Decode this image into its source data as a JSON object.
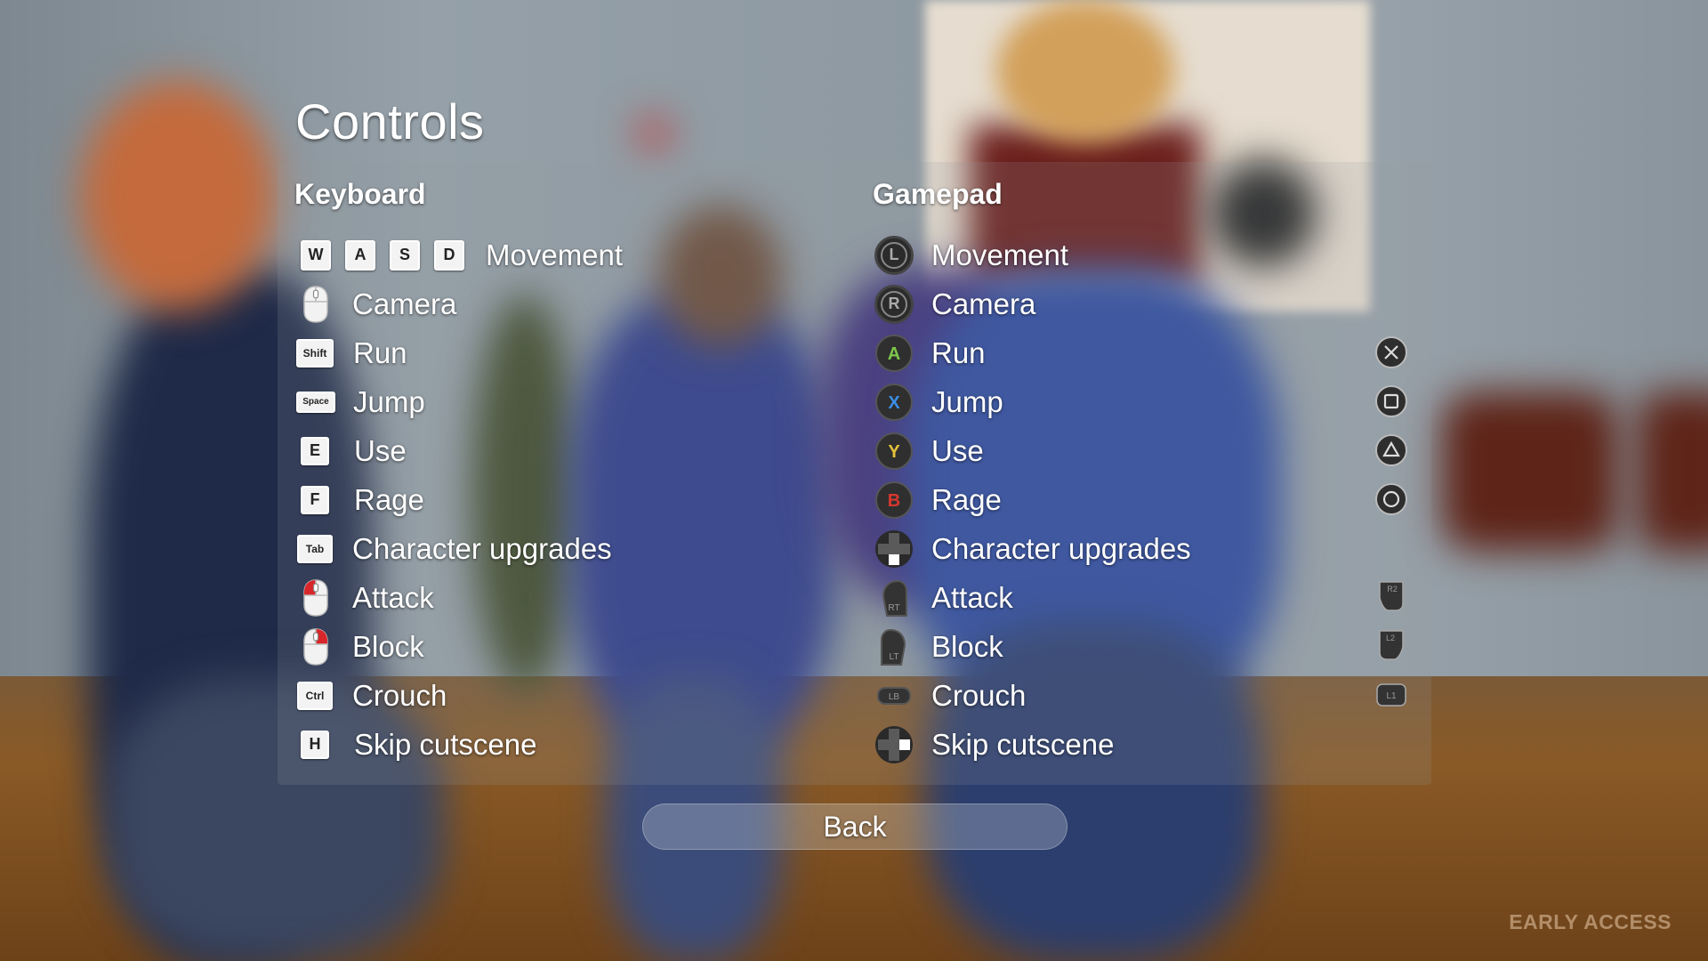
{
  "screen": {
    "title": "Controls",
    "watermark": "EARLY ACCESS"
  },
  "keyboard": {
    "heading": "Keyboard",
    "rows": [
      {
        "keys": [
          "W",
          "A",
          "S",
          "D"
        ],
        "label": "Movement"
      },
      {
        "icon": "mouse-move-icon",
        "label": "Camera"
      },
      {
        "key": "Shift",
        "label": "Run"
      },
      {
        "key": "Space",
        "label": "Jump"
      },
      {
        "key": "E",
        "label": "Use"
      },
      {
        "key": "F",
        "label": "Rage"
      },
      {
        "key": "Tab",
        "label": "Character upgrades"
      },
      {
        "icon": "mouse-left-click-icon",
        "label": "Attack"
      },
      {
        "icon": "mouse-right-click-icon",
        "label": "Block"
      },
      {
        "key": "Ctrl",
        "label": "Crouch"
      },
      {
        "key": "H",
        "label": "Skip cutscene"
      }
    ]
  },
  "gamepad": {
    "heading": "Gamepad",
    "rows": [
      {
        "xbox": "L",
        "label": "Movement"
      },
      {
        "xbox": "R",
        "label": "Camera"
      },
      {
        "xbox": "A",
        "label": "Run",
        "ps": "cross"
      },
      {
        "xbox": "X",
        "label": "Jump",
        "ps": "square"
      },
      {
        "xbox": "Y",
        "label": "Use",
        "ps": "triangle"
      },
      {
        "xbox": "B",
        "label": "Rage",
        "ps": "circle"
      },
      {
        "xbox": "dpad-down",
        "label": "Character upgrades"
      },
      {
        "xbox": "RT",
        "label": "Attack",
        "ps": "R2"
      },
      {
        "xbox": "LT",
        "label": "Block",
        "ps": "L2"
      },
      {
        "xbox": "LB",
        "label": "Crouch",
        "ps": "L1"
      },
      {
        "xbox": "dpad-right",
        "label": "Skip cutscene"
      }
    ]
  },
  "colors": {
    "a": "#7cc84a",
    "x": "#3a8ee6",
    "y": "#e6c23a",
    "b": "#d6372e",
    "mouse_accent": "#d9262a"
  },
  "back_button": {
    "label": "Back"
  }
}
